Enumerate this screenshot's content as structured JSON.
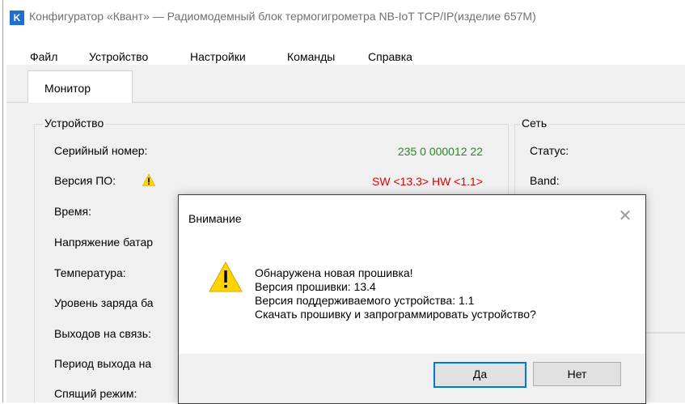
{
  "window": {
    "app_icon_letter": "K",
    "title": "Конфигуратор «Квант» — Радиомодемный блок термогигрометра NB-IoT TCP/IP(изделие 657M)"
  },
  "menu": [
    "Файл",
    "Устройство",
    "Настройки",
    "Команды",
    "Справка"
  ],
  "tabs": [
    {
      "label": "Монитор",
      "active": true
    }
  ],
  "device_group": {
    "legend": "Устройство",
    "rows": [
      {
        "label": "Серийный номер:",
        "value": "235 0 000012 22",
        "value_color": "#228b22"
      },
      {
        "label": "Версия ПО:",
        "value": "SW <13.3> HW <1.1>",
        "value_color": "#e00000",
        "warning_icon": "warning-icon"
      },
      {
        "label": "Время:",
        "value": ""
      },
      {
        "label": "Напряжение батар",
        "value": ""
      },
      {
        "label": "Температура:",
        "value": ""
      },
      {
        "label": "Уровень заряда ба",
        "value": ""
      },
      {
        "label": "Выходов на связь:",
        "value": ""
      },
      {
        "label": "Период выхода на",
        "value": ""
      },
      {
        "label": "Спящий режим:",
        "value": ""
      }
    ]
  },
  "network_group": {
    "legend": "Сеть",
    "rows": [
      {
        "label": "Статус:"
      },
      {
        "label": "Band:"
      }
    ]
  },
  "dialog": {
    "title": "Внимание",
    "close_icon": "close-icon",
    "warning_icon": "warning-icon",
    "message_lines": [
      "Обнаружена новая прошивка!",
      "Версия прошивки: 13.4",
      "Версия поддерживаемого устройства: 1.1",
      "Скачать прошивку и запрограммировать устройство?"
    ],
    "yes_label": "Да",
    "no_label": "Нет"
  },
  "colors": {
    "ok_value": "#228b22",
    "error_value": "#e00000",
    "default_button_border": "#0078d7",
    "warning_yellow": "#ffd400"
  }
}
